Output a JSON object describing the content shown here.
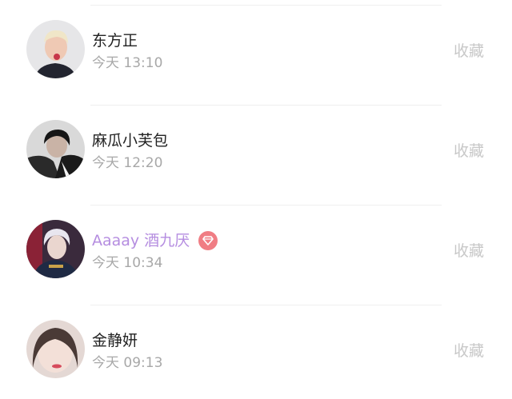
{
  "list": {
    "items": [
      {
        "name": "东方正",
        "time": "今天 13:10",
        "action": "收藏",
        "vip": false
      },
      {
        "name": "麻瓜小芙包",
        "time": "今天 12:20",
        "action": "收藏",
        "vip": false
      },
      {
        "name": "Aaaay 酒九厌",
        "time": "今天 10:34",
        "action": "收藏",
        "vip": true
      },
      {
        "name": "金静妍",
        "time": "今天 09:13",
        "action": "收藏",
        "vip": false
      }
    ]
  },
  "colors": {
    "vip_name": "#b58de0",
    "vip_badge": "#f07d84",
    "secondary_text": "#a8a8a8",
    "action_text": "#c8c8c8"
  },
  "icons": {
    "vip_badge": "diamond-icon"
  }
}
